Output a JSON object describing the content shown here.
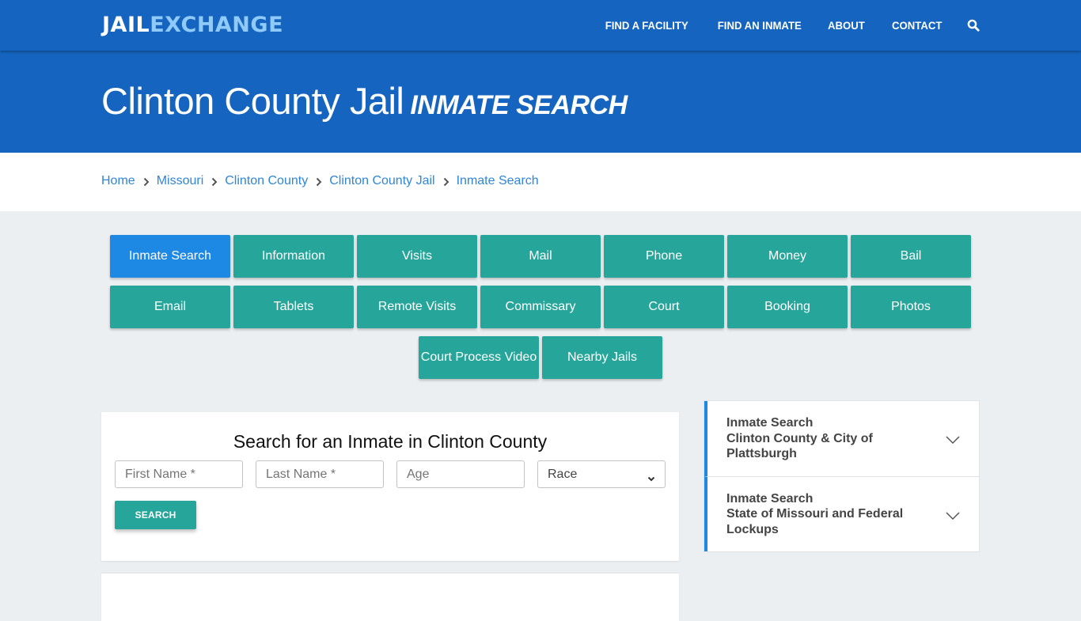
{
  "brand": {
    "logo_part1": "JAIL",
    "logo_part2": "EXCHANGE",
    "primary_color": "#1565c0",
    "accent_color": "#26a69a",
    "active_color": "#1e88e5"
  },
  "nav": {
    "items": [
      {
        "label": "FIND A FACILITY"
      },
      {
        "label": "FIND AN INMATE"
      },
      {
        "label": "ABOUT"
      },
      {
        "label": "CONTACT"
      }
    ],
    "search_icon": "search-icon"
  },
  "hero": {
    "title": "Clinton County Jail",
    "subtitle": "INMATE SEARCH"
  },
  "breadcrumb": {
    "items": [
      {
        "label": "Home"
      },
      {
        "label": "Missouri"
      },
      {
        "label": "Clinton County"
      },
      {
        "label": "Clinton County Jail"
      },
      {
        "label": "Inmate Search"
      }
    ],
    "separator_icon": "chevron-right-icon"
  },
  "buttons": {
    "rows": [
      [
        {
          "label": "Inmate Search",
          "active": true
        },
        {
          "label": "Information"
        },
        {
          "label": "Visits"
        },
        {
          "label": "Mail"
        },
        {
          "label": "Phone"
        },
        {
          "label": "Money"
        },
        {
          "label": "Bail"
        }
      ],
      [
        {
          "label": "Email"
        },
        {
          "label": "Tablets"
        },
        {
          "label": "Remote Visits"
        },
        {
          "label": "Commissary"
        },
        {
          "label": "Court"
        },
        {
          "label": "Booking"
        },
        {
          "label": "Photos"
        }
      ],
      [
        {
          "label": "Court Process Video"
        },
        {
          "label": "Nearby Jails"
        }
      ]
    ]
  },
  "search_form": {
    "heading": "Search for an Inmate in Clinton County",
    "first_name": {
      "placeholder": "First Name *",
      "value": ""
    },
    "last_name": {
      "placeholder": "Last Name *",
      "value": ""
    },
    "age": {
      "placeholder": "Age",
      "value": ""
    },
    "race": {
      "selected": "Race"
    },
    "submit_label": "SEARCH"
  },
  "sidebar": {
    "accordions": [
      {
        "line1": "Inmate Search",
        "line2": "Clinton County & City of Plattsburgh"
      },
      {
        "line1": "Inmate Search",
        "line2": "State of Missouri and Federal Lockups"
      }
    ]
  }
}
